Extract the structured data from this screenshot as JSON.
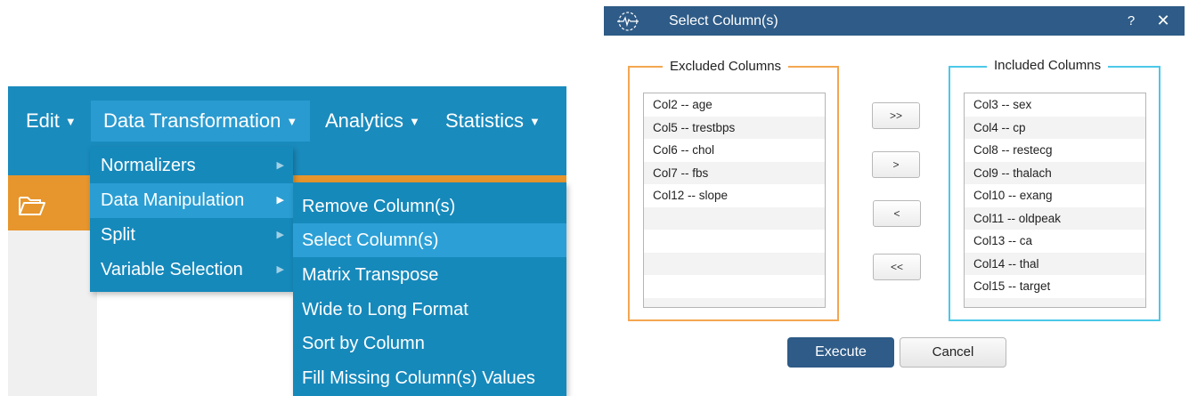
{
  "menubar": {
    "items": [
      {
        "label": "Edit",
        "caret": "▼"
      },
      {
        "label": "Data Transformation",
        "caret": "▼"
      },
      {
        "label": "Analytics",
        "caret": "▼"
      },
      {
        "label": "Statistics",
        "caret": "▼"
      }
    ]
  },
  "submenu_data_transformation": {
    "items": [
      {
        "label": "Normalizers",
        "arrow": "▶"
      },
      {
        "label": "Data Manipulation",
        "arrow": "▶"
      },
      {
        "label": "Split",
        "arrow": "▶"
      },
      {
        "label": "Variable Selection",
        "arrow": "▶"
      }
    ],
    "active_label": "Data Manipulation"
  },
  "submenu_data_manipulation": {
    "items": [
      "Remove Column(s)",
      "Select Column(s)",
      "Matrix Transpose",
      "Wide to Long Format",
      "Sort by Column",
      "Fill Missing Column(s) Values"
    ],
    "active_label": "Select Column(s)"
  },
  "toolbar": {
    "open_icon": "folder-open-icon"
  },
  "dialog": {
    "title": "Select Column(s)",
    "help": "?",
    "close": "✕",
    "excluded": {
      "legend": "Excluded Columns",
      "items": [
        "Col2 -- age",
        "Col5 -- trestbps",
        "Col6 -- chol",
        "Col7 -- fbs",
        "Col12 -- slope"
      ]
    },
    "included": {
      "legend": "Included Columns",
      "items": [
        "Col3 -- sex",
        "Col4 -- cp",
        "Col8 -- restecg",
        "Col9 -- thalach",
        "Col10 -- exang",
        "Col11 -- oldpeak",
        "Col13 -- ca",
        "Col14 -- thal",
        "Col15 -- target"
      ]
    },
    "buttons": {
      "move_all_right": ">>",
      "move_right": ">",
      "move_left": "<",
      "move_all_left": "<<",
      "execute": "Execute",
      "cancel": "Cancel"
    }
  },
  "colors": {
    "menubar": "#1a8bbd",
    "menu_active": "#2a9ed3",
    "toolbar": "#e7962d",
    "dialog_title": "#2e5b87",
    "excluded_border": "#f4a651",
    "included_border": "#4bc8e8"
  }
}
